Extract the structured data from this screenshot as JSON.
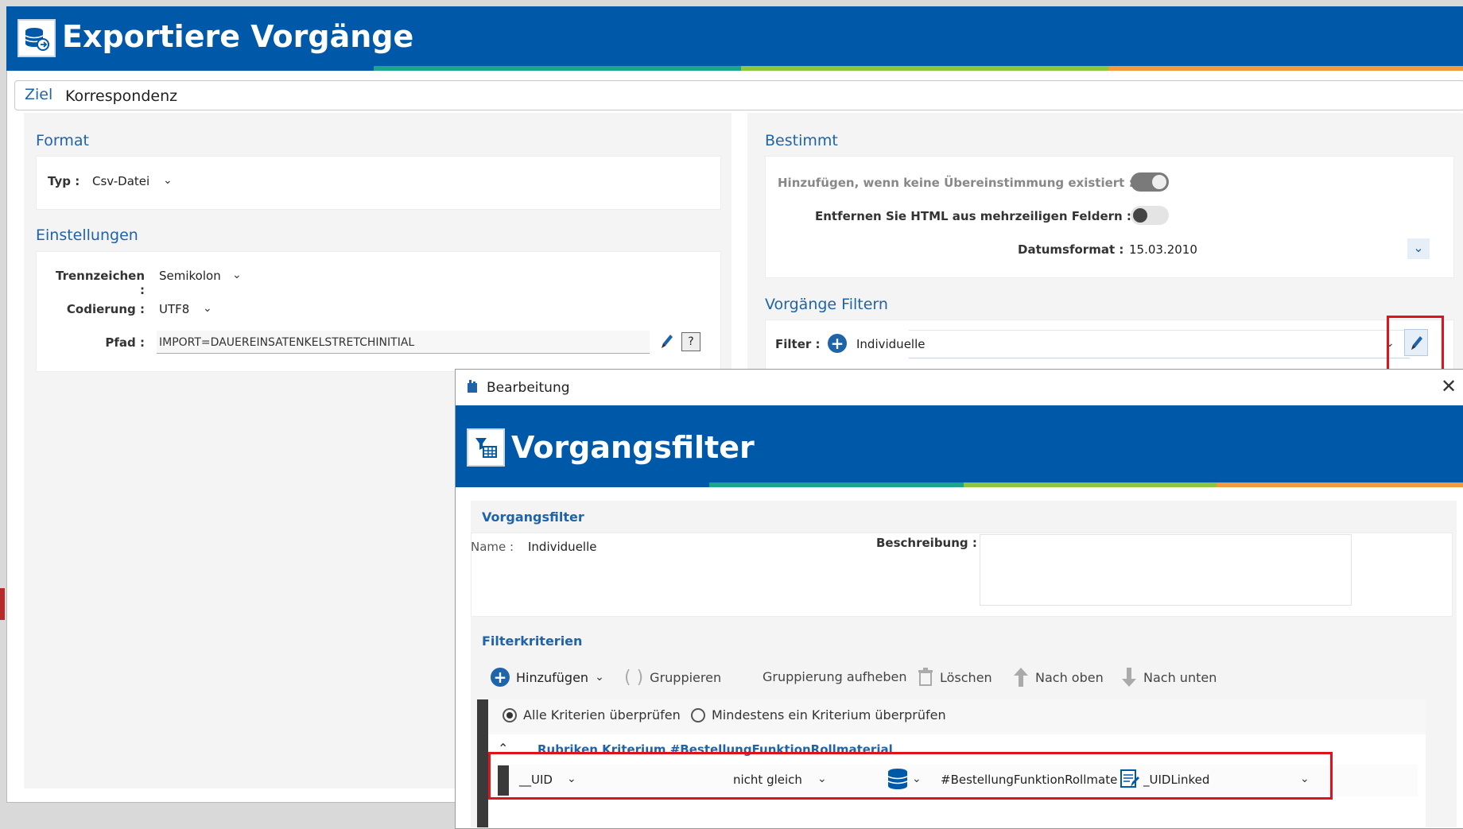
{
  "app": {
    "title": "Exportiere Vorgänge"
  },
  "ziel": {
    "label": "Ziel",
    "value": "Korrespondenz"
  },
  "format": {
    "section": "Format",
    "typ_label": "Typ :",
    "typ_value": "Csv-Datei"
  },
  "einstellungen": {
    "section": "Einstellungen",
    "trennzeichen_label": "Trennzeichen :",
    "trennzeichen_value": "Semikolon",
    "codierung_label": "Codierung :",
    "codierung_value": "UTF8",
    "pfad_label": "Pfad :",
    "pfad_value": "IMPORT=DAUEREINSATENKELSTRETCHINITIAL",
    "help_label": "?"
  },
  "bestimmt": {
    "section": "Bestimmt",
    "hinzufuegen_label": "Hinzufügen, wenn keine Übereinstimmung existiert :",
    "entfernen_label": "Entfernen Sie HTML aus mehrzeiligen Feldern :",
    "datumsformat_label": "Datumsformat :",
    "datumsformat_value": "15.03.2010"
  },
  "filtern": {
    "section": "Vorgänge Filtern",
    "filter_label": "Filter :",
    "filter_value": "Individuelle"
  },
  "dialog": {
    "window_title": "Bearbeitung",
    "banner_title": "Vorgangsfilter",
    "section_vorgangsfilter": "Vorgangsfilter",
    "name_label": "Name :",
    "name_value": "Individuelle",
    "beschreibung_label": "Beschreibung :",
    "section_filterkriterien": "Filterkriterien",
    "toolbar": {
      "hinzufuegen": "Hinzufügen",
      "gruppieren": "Gruppieren",
      "gruppierung_aufheben": "Gruppierung aufheben",
      "loeschen": "Löschen",
      "nach_oben": "Nach oben",
      "nach_unten": "Nach unten"
    },
    "radio_all": "Alle Kriterien überprüfen",
    "radio_any": "Mindestens ein Kriterium überprüfen",
    "group_title": "Rubriken Kriterium #BestellungFunktionRollmaterial",
    "row": {
      "field": "__UID",
      "operator": "nicht gleich",
      "source": "#BestellungFunktionRollmater",
      "target": "_UIDLinked"
    }
  },
  "colors": {
    "brand": "#0058a8",
    "accent_red": "#e0131c",
    "title_blue": "#1f63a8"
  }
}
